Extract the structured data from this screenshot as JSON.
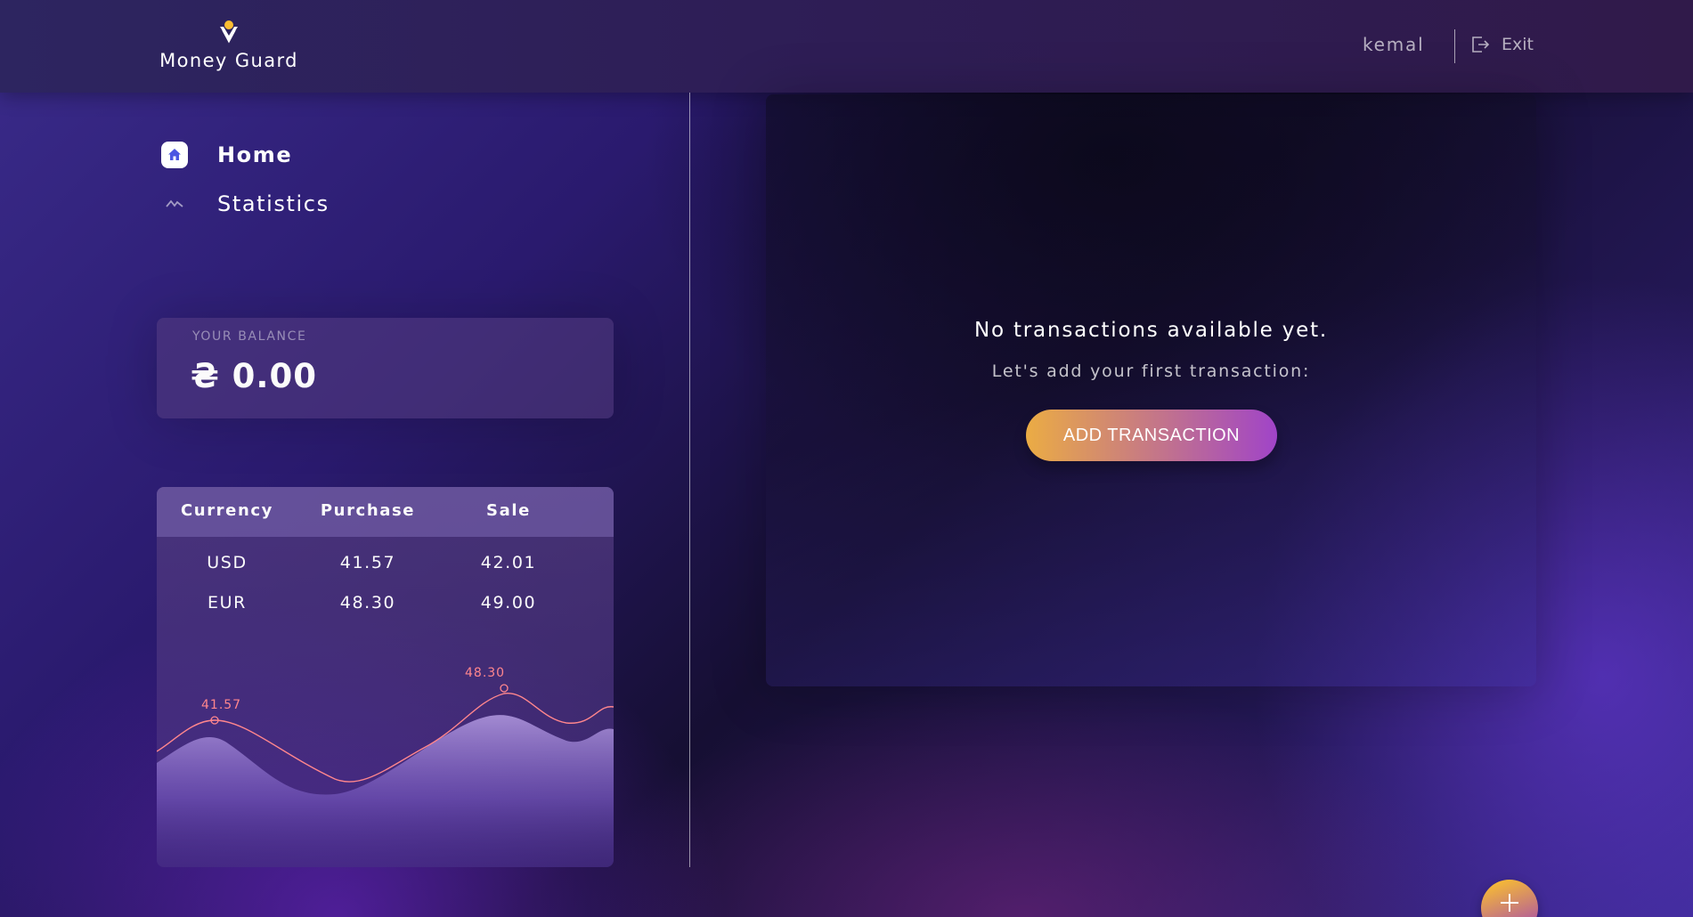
{
  "app": {
    "name": "Money Guard",
    "user": "kemal",
    "exit_label": "Exit"
  },
  "sidebar": {
    "nav": [
      {
        "label": "Home",
        "icon": "home-icon",
        "active": true
      },
      {
        "label": "Statistics",
        "icon": "statistics-icon",
        "active": false
      }
    ],
    "balance": {
      "label": "YOUR BALANCE",
      "value": "₴ 0.00"
    },
    "currency_table": {
      "headers": [
        "Currency",
        "Purchase",
        "Sale"
      ],
      "rows": [
        [
          "USD",
          "41.57",
          "42.01"
        ],
        [
          "EUR",
          "48.30",
          "49.00"
        ]
      ]
    }
  },
  "chart_data": {
    "type": "line",
    "series": [
      {
        "values": [
          41.57,
          48.3
        ]
      }
    ],
    "annotations": [
      "41.57",
      "48.30"
    ]
  },
  "main": {
    "empty_title": "No transactions available yet.",
    "empty_subtitle": "Let's add your first transaction:",
    "add_button_label": "ADD TRANSACTION"
  },
  "colors": {
    "accent_orange": "#ebac44",
    "accent_purple": "#a044c8",
    "chart_line": "#ff868d"
  }
}
